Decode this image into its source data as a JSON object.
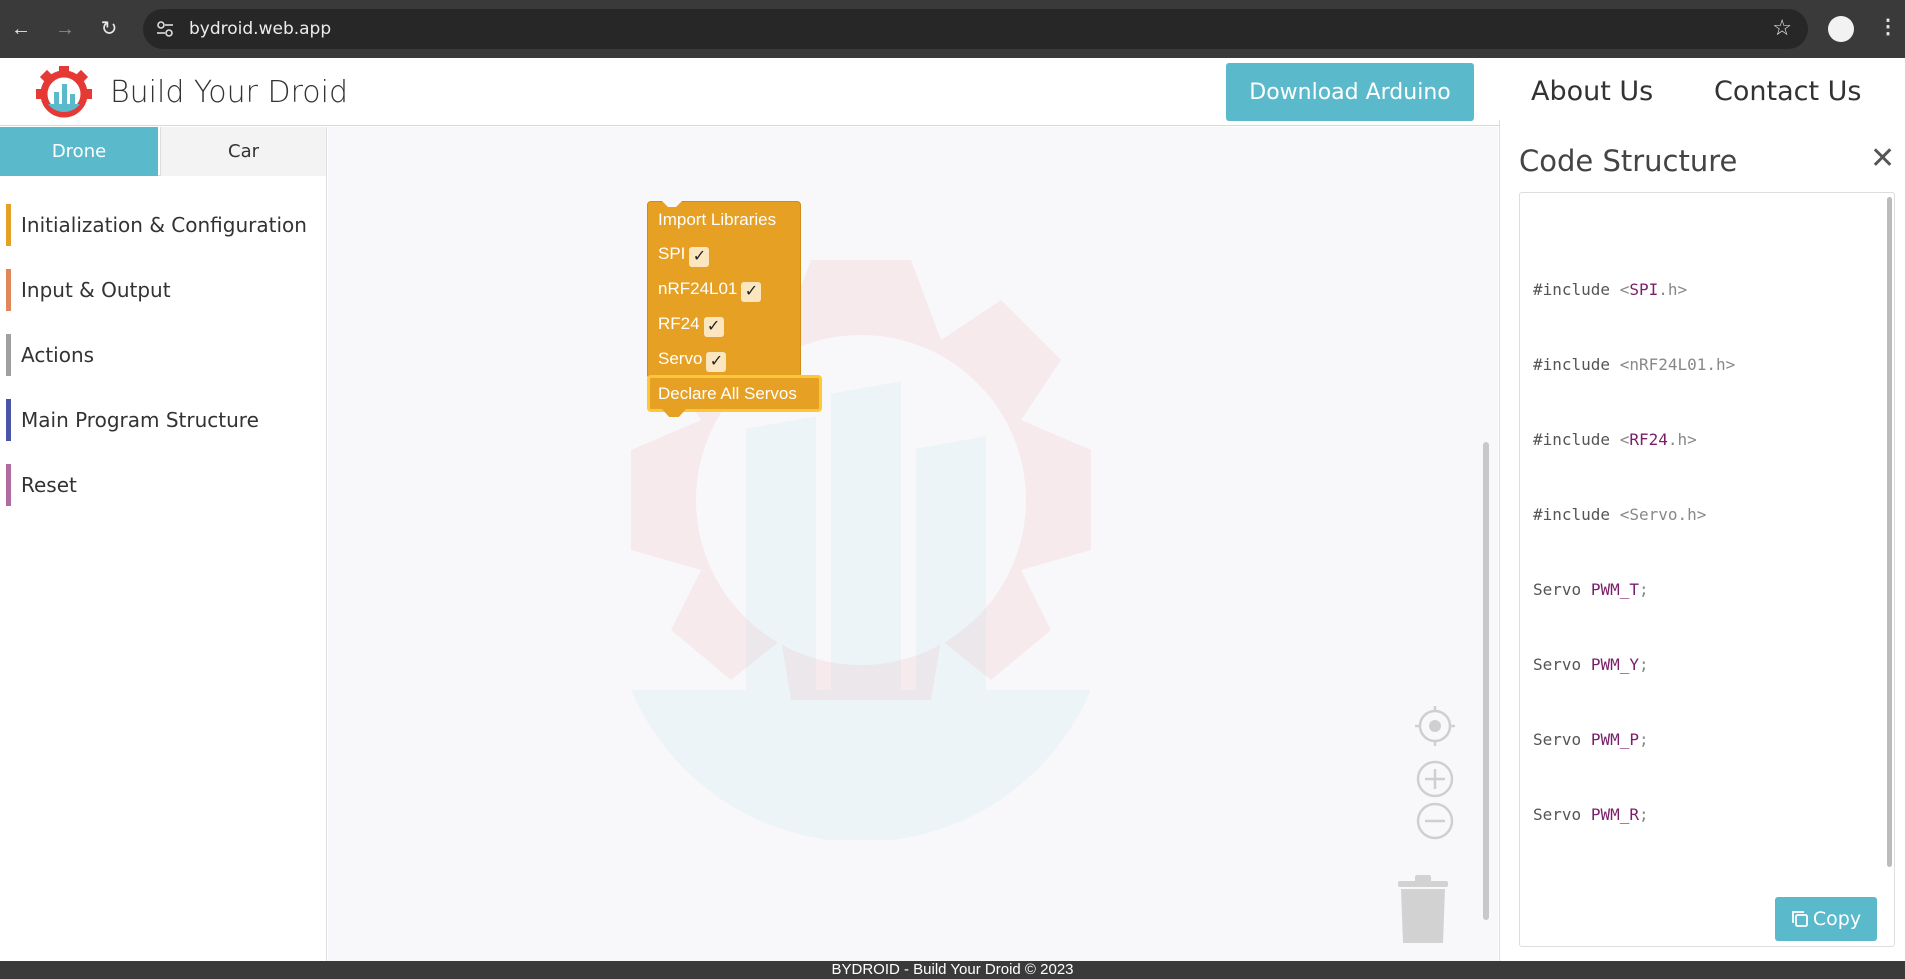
{
  "browser": {
    "url": "bydroid.web.app"
  },
  "header": {
    "brand": "Build Your Droid",
    "download_label": "Download Arduino",
    "about_label": "About Us",
    "contact_label": "Contact Us",
    "accent_color": "#5bb9cc"
  },
  "sidebar": {
    "tabs": [
      {
        "label": "Drone",
        "active": true
      },
      {
        "label": "Car",
        "active": false
      }
    ],
    "categories": [
      {
        "label": "Initialization & Configuration",
        "color": "#e6a024"
      },
      {
        "label": "Input & Output",
        "color": "#e0875a"
      },
      {
        "label": "Actions",
        "color": "#a0a0a0"
      },
      {
        "label": "Main Program Structure",
        "color": "#4a55a8"
      },
      {
        "label": "Reset",
        "color": "#b06ca0"
      }
    ]
  },
  "workspace": {
    "import_block": {
      "title": "Import Libraries",
      "libs": [
        {
          "name": "SPI",
          "check": "✓"
        },
        {
          "name": "nRF24L01",
          "check": "✓"
        },
        {
          "name": "RF24",
          "check": "✓"
        },
        {
          "name": "Servo",
          "check": "✓"
        }
      ]
    },
    "declare_block": {
      "label": "Declare All Servos"
    },
    "block_color": "#e6a024"
  },
  "code_panel": {
    "title": "Code Structure",
    "close_symbol": "✕",
    "copy_label": "Copy",
    "includes": [
      {
        "kw": "#include",
        "open": "<",
        "name": "SPI",
        "ext": ".h>"
      },
      {
        "kw": "#include",
        "open": "<",
        "name": "",
        "ext": "nRF24L01.h>"
      },
      {
        "kw": "#include",
        "open": "<",
        "name": "RF24",
        "ext": ".h>"
      },
      {
        "kw": "#include",
        "open": "<",
        "name": "",
        "ext": "Servo.h>"
      }
    ],
    "servos": [
      {
        "type": "Servo",
        "name": "PWM_T",
        "end": ";"
      },
      {
        "type": "Servo",
        "name": "PWM_Y",
        "end": ";"
      },
      {
        "type": "Servo",
        "name": "PWM_P",
        "end": ";"
      },
      {
        "type": "Servo",
        "name": "PWM_R",
        "end": ";"
      }
    ]
  },
  "footer": {
    "text": "BYDROID - Build Your Droid © 2023"
  }
}
